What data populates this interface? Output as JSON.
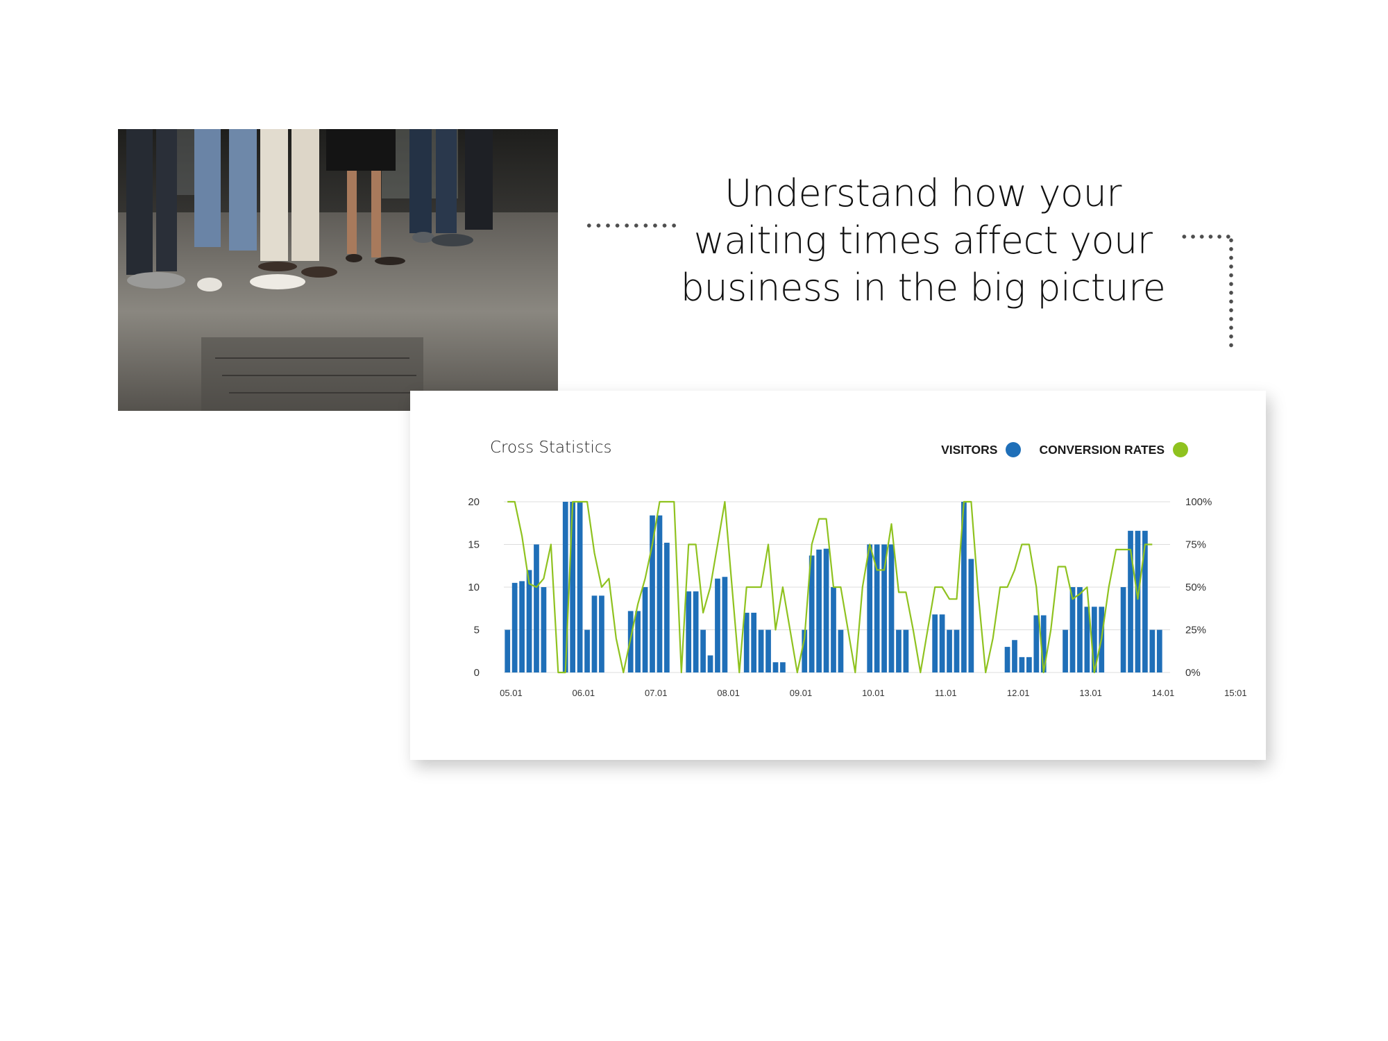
{
  "headline": {
    "line1": "Understand how your",
    "line2": "waiting times affect your",
    "line3": "business in the big picture"
  },
  "card": {
    "title": "Cross Statistics"
  },
  "colors": {
    "visitors": "#1f6fb8",
    "conversion": "#8fc21f",
    "grid": "#dcdcdc"
  },
  "chart_data": {
    "type": "bar",
    "title": "Cross Statistics",
    "legend": [
      "VISITORS",
      "CONVERSION RATES"
    ],
    "legend_position": "top-right",
    "grid": true,
    "ylim_left": [
      0,
      20
    ],
    "ylim_right": [
      0,
      100
    ],
    "y_ticks_left": [
      "0",
      "5",
      "10",
      "15",
      "20"
    ],
    "y_ticks_right": [
      "0%",
      "25%",
      "50%",
      "75%",
      "100%"
    ],
    "x_labels": [
      "05.01",
      "06.01",
      "07.01",
      "08.01",
      "09.01",
      "10.01",
      "11.01",
      "12.01",
      "13.01",
      "14.01",
      "15:01"
    ],
    "points_per_day": 10,
    "series": [
      {
        "name": "VISITORS",
        "type": "bar",
        "axis": "left",
        "values": [
          5,
          10.5,
          10.7,
          12,
          15,
          10,
          0,
          0,
          20,
          20,
          20,
          5,
          9,
          9,
          0,
          0,
          0,
          7.2,
          7.2,
          10,
          18.4,
          18.4,
          15.2,
          0,
          0,
          9.5,
          9.5,
          5,
          2,
          11,
          11.2,
          0,
          0,
          7,
          7,
          5,
          5,
          1.2,
          1.2,
          0,
          0,
          5,
          13.7,
          14.4,
          14.5,
          10,
          5,
          0,
          0,
          0,
          15,
          15,
          15,
          15,
          5,
          5,
          0,
          0,
          0,
          6.8,
          6.8,
          5,
          5,
          20,
          13.3,
          0,
          0,
          0,
          0,
          3,
          3.8,
          1.8,
          1.8,
          6.7,
          6.7,
          0,
          0,
          5,
          10,
          10,
          7.7,
          7.7,
          7.7,
          0,
          0,
          10,
          16.6,
          16.6,
          16.6,
          5,
          5
        ]
      },
      {
        "name": "CONVERSION RATES",
        "type": "line",
        "axis": "right",
        "values": [
          100,
          100,
          80,
          52,
          50,
          55,
          75,
          0,
          0,
          100,
          100,
          100,
          70,
          50,
          55,
          20,
          0,
          20,
          40,
          55,
          75,
          100,
          100,
          100,
          0,
          75,
          75,
          35,
          50,
          75,
          100,
          50,
          0,
          50,
          50,
          50,
          75,
          25,
          50,
          25,
          0,
          20,
          75,
          90,
          90,
          50,
          50,
          25,
          0,
          50,
          75,
          60,
          60,
          87,
          47,
          47,
          25,
          0,
          25,
          50,
          50,
          43,
          43,
          100,
          100,
          45,
          0,
          20,
          50,
          50,
          60,
          75,
          75,
          50,
          0,
          25,
          62,
          62,
          43,
          46,
          50,
          0,
          20,
          50,
          72,
          72,
          72,
          43,
          75,
          75
        ]
      }
    ]
  }
}
